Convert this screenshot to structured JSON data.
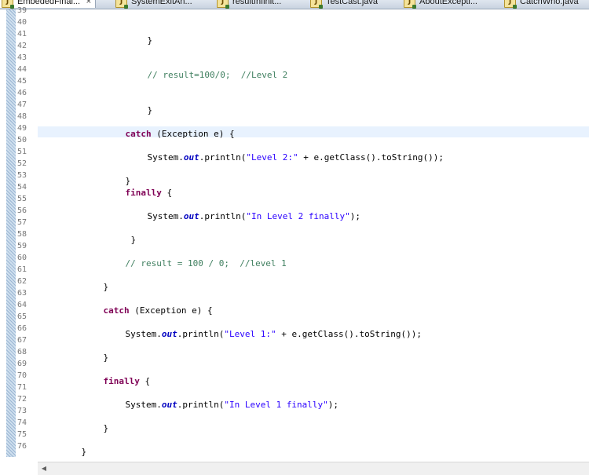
{
  "tabs": [
    {
      "label": "EmbededFinal...",
      "active": true,
      "close": "×"
    },
    {
      "label": "SystemExitAn..."
    },
    {
      "label": "resultInfinit..."
    },
    {
      "label": "TestCast.java"
    },
    {
      "label": "AboutExcepti..."
    },
    {
      "label": "CatchWho.java"
    }
  ],
  "java_icon_glyph": "J",
  "editor": {
    "line_numbers": [
      "39",
      "40",
      "41",
      "42",
      "43",
      "44",
      "45",
      "46",
      "47",
      "48",
      "49",
      "50",
      "51",
      "52",
      "53",
      "54",
      "55",
      "56",
      "57",
      "58",
      "59",
      "60",
      "61",
      "62",
      "63",
      "64",
      "65",
      "66",
      "67",
      "68",
      "69",
      "70",
      "71",
      "72",
      "73",
      "74",
      "75",
      "76"
    ],
    "code": {
      "l40": {
        "brace": "}"
      },
      "l43": {
        "comment": "// result=100/0;  //Level 2"
      },
      "l46": {
        "brace": "}"
      },
      "l48": {
        "kw": "catch",
        "rest": " (Exception e) {"
      },
      "l50": {
        "pre": "System.",
        "field": "out",
        "mid": ".println(",
        "str": "\"Level 2:\"",
        "post": " + e.getClass().toString());"
      },
      "l52": {
        "brace": "}"
      },
      "l53": {
        "kw": "finally",
        "rest": " {"
      },
      "l55": {
        "pre": "System.",
        "field": "out",
        "mid": ".println(",
        "str": "\"In Level 2 finally\"",
        "post": ");"
      },
      "l57": {
        "brace": "}"
      },
      "l59": {
        "comment": "// result = 100 / 0;  //level 1"
      },
      "l61": {
        "brace": "}"
      },
      "l63": {
        "kw": "catch",
        "rest": " (Exception e) {"
      },
      "l65": {
        "pre": "System.",
        "field": "out",
        "mid": ".println(",
        "str": "\"Level 1:\"",
        "post": " + e.getClass().toString());"
      },
      "l67": {
        "brace": "}"
      },
      "l69": {
        "kw": "finally",
        "rest": " {"
      },
      "l71": {
        "pre": "System.",
        "field": "out",
        "mid": ".println(",
        "str": "\"In Level 1 finally\"",
        "post": ");"
      },
      "l73": {
        "brace": "}"
      },
      "l75": {
        "brace": "}"
      }
    }
  },
  "scrollbar": {
    "left_arrow": "◀"
  },
  "colors": {
    "keyword": "#7f0055",
    "comment": "#3f7f5f",
    "string": "#2a00ff",
    "static_field": "#0000c0",
    "current_line": "#e8f2fe"
  }
}
